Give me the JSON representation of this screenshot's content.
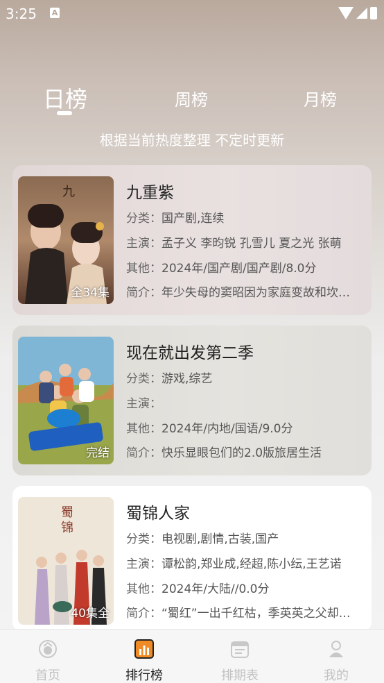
{
  "status_bar": {
    "time": "3:25",
    "notification_glyph": "A"
  },
  "tabs": [
    {
      "label": "日榜",
      "active": true
    },
    {
      "label": "周榜",
      "active": false
    },
    {
      "label": "月榜",
      "active": false
    }
  ],
  "subtitle": "根据当前热度整理 不定时更新",
  "labels": {
    "category": "分类：",
    "cast": "主演：",
    "other": "其他：",
    "synopsis": "简介："
  },
  "items": [
    {
      "title": "九重紫",
      "badge": "全34集",
      "category": "国产剧,连续",
      "cast": "孟子义 李昀锐 孔雪儿 夏之光 张萌",
      "other": "2024年/国产剧/国产剧/8.0分",
      "synopsis": "年少失母的窦昭因为家庭变故和坎…"
    },
    {
      "title": "现在就出发第二季",
      "badge": "完结",
      "category": "游戏,综艺",
      "cast": "",
      "other": "2024年/内地/国语/9.0分",
      "synopsis": "快乐显眼包们的2.0版旅居生活"
    },
    {
      "title": "蜀锦人家",
      "badge": "40集全",
      "category": "电视剧,剧情,古装,国产",
      "cast": "谭松韵,郑业成,经超,陈小纭,王艺诺",
      "other": "2024年/大陆//0.0分",
      "synopsis": "“蜀红”一出千红枯，季英英之父却…"
    }
  ],
  "bottom_nav": [
    {
      "label": "首页",
      "icon": "home-icon",
      "active": false
    },
    {
      "label": "排行榜",
      "icon": "ranking-icon",
      "active": true
    },
    {
      "label": "排期表",
      "icon": "calendar-icon",
      "active": false
    },
    {
      "label": "我的",
      "icon": "profile-icon",
      "active": false
    }
  ],
  "colors": {
    "accent": "#f08a24",
    "inactive": "#c2c2c2",
    "text": "#222222"
  }
}
